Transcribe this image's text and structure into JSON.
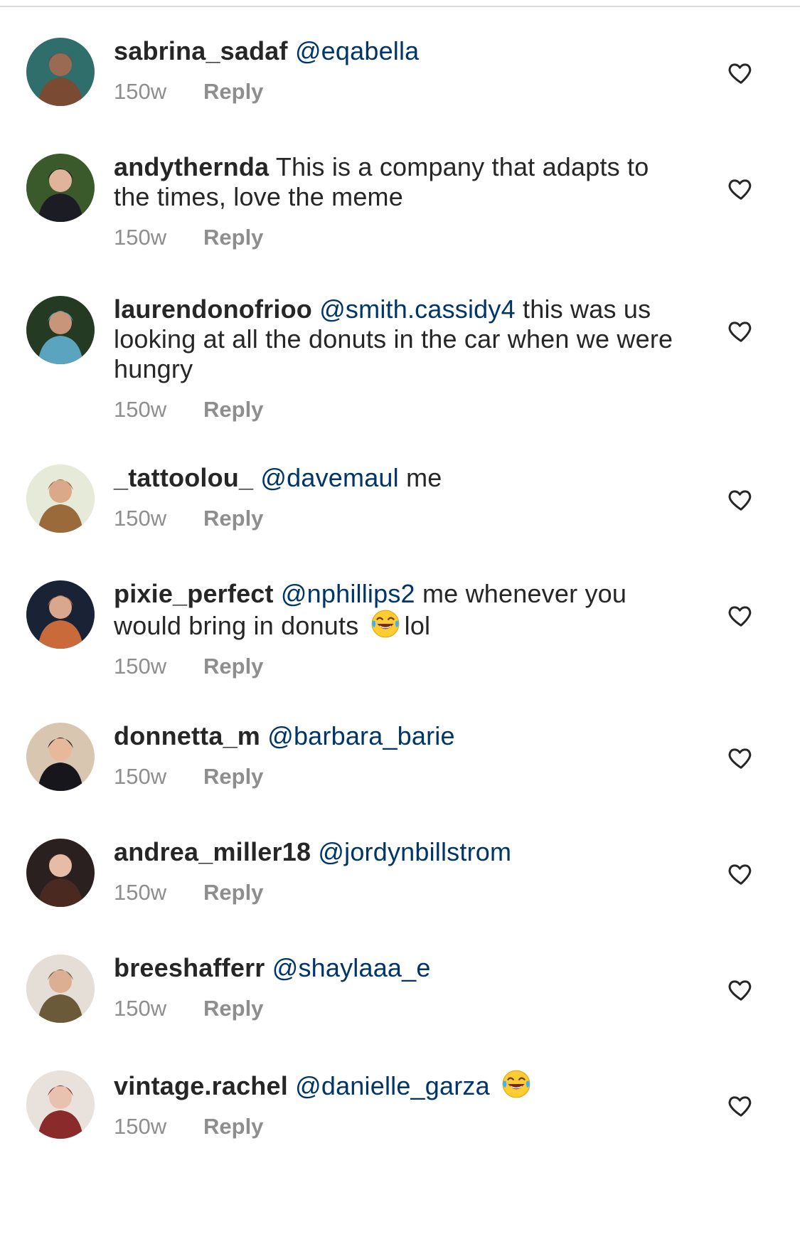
{
  "comments": [
    {
      "username": "sabrina_sadaf",
      "mention": "@eqabella",
      "text": "",
      "emoji_after": false,
      "trailing": "",
      "time": "150w",
      "reply_label": "Reply",
      "avatar": {
        "bg": "#2f6e6a",
        "accent": "#7a4a33",
        "skin": "#9a6b52"
      }
    },
    {
      "username": "andythernda",
      "mention": "",
      "text": "This is a company that adapts to the times, love the meme",
      "emoji_after": false,
      "trailing": "",
      "time": "150w",
      "reply_label": "Reply",
      "avatar": {
        "bg": "#3a5a2c",
        "accent": "#1c1c24",
        "skin": "#e0b49a"
      }
    },
    {
      "username": "laurendonofrioo",
      "mention": "@smith.cassidy4",
      "text": "this was us looking at all the donuts in the car when we were hungry",
      "emoji_after": false,
      "trailing": "",
      "time": "150w",
      "reply_label": "Reply",
      "avatar": {
        "bg": "#243a22",
        "accent": "#5aa4c0",
        "skin": "#c8957a"
      }
    },
    {
      "username": "_tattoolou_",
      "mention": "@davemaul",
      "text": "me",
      "emoji_after": false,
      "trailing": "",
      "time": "150w",
      "reply_label": "Reply",
      "avatar": {
        "bg": "#e6ead8",
        "accent": "#9a6a3a",
        "skin": "#d9a98a"
      }
    },
    {
      "username": "pixie_perfect",
      "mention": "@nphillips2",
      "text": "me whenever you would bring in donuts",
      "emoji_after": true,
      "trailing": "lol",
      "time": "150w",
      "reply_label": "Reply",
      "avatar": {
        "bg": "#1a2236",
        "accent": "#c96a3a",
        "skin": "#d9a68e"
      }
    },
    {
      "username": "donnetta_m",
      "mention": "@barbara_barie",
      "text": "",
      "emoji_after": false,
      "trailing": "",
      "time": "150w",
      "reply_label": "Reply",
      "avatar": {
        "bg": "#d9c6b0",
        "accent": "#16161c",
        "skin": "#e8b89a"
      }
    },
    {
      "username": "andrea_miller18",
      "mention": "@jordynbillstrom",
      "text": "",
      "emoji_after": false,
      "trailing": "",
      "time": "150w",
      "reply_label": "Reply",
      "avatar": {
        "bg": "#2a2020",
        "accent": "#4a2a20",
        "skin": "#e6bca6"
      }
    },
    {
      "username": "breeshafferr",
      "mention": "@shaylaaa_e",
      "text": "",
      "emoji_after": false,
      "trailing": "",
      "time": "150w",
      "reply_label": "Reply",
      "avatar": {
        "bg": "#e4ded6",
        "accent": "#6a5a3a",
        "skin": "#dcae92"
      }
    },
    {
      "username": "vintage.rachel",
      "mention": "@danielle_garza",
      "text": "",
      "emoji_after": true,
      "trailing": "",
      "time": "150w",
      "reply_label": "Reply",
      "avatar": {
        "bg": "#e9e2dc",
        "accent": "#8a2a2a",
        "skin": "#e8c2ae"
      }
    }
  ],
  "icons": {
    "like": "heart-outline-icon",
    "emoji": "face-with-tears-of-joy-icon"
  },
  "colors": {
    "mention": "#003569",
    "meta": "#8e8e8e",
    "text": "#262626",
    "divider": "#dbdbdb"
  }
}
